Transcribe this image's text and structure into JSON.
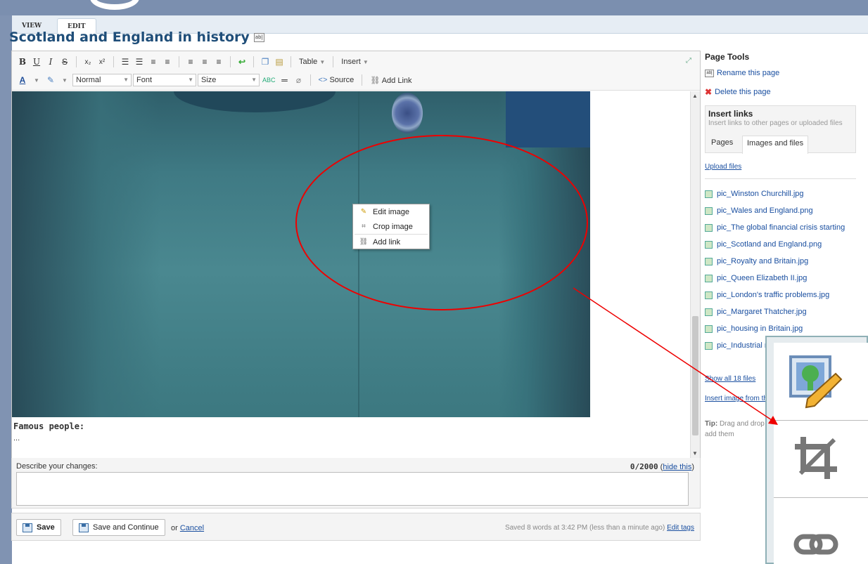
{
  "tabs": {
    "view": "VIEW",
    "edit": "EDIT"
  },
  "page": {
    "title": "Scotland and England in history"
  },
  "toolbar": {
    "bold": "B",
    "underline": "U",
    "italic": "I",
    "strike": "S",
    "table": "Table",
    "insert": "Insert",
    "format_value": "Normal",
    "font_value": "Font",
    "size_value": "Size",
    "source": "Source",
    "add_link": "Add Link"
  },
  "context_menu": {
    "items": [
      "Edit image",
      "Crop image",
      "Add link"
    ]
  },
  "content": {
    "heading": "Famous people:",
    "line": "..."
  },
  "changes": {
    "label": "Describe your changes:",
    "count": "0/2000",
    "hide": "hide this"
  },
  "buttons": {
    "save": "Save",
    "save_continue": "Save and Continue",
    "or": "or",
    "cancel": "Cancel"
  },
  "status": {
    "saved": "Saved 8 words at 3:42 PM (less than a minute ago)",
    "edit_tags": "Edit tags"
  },
  "sidebar": {
    "heading": "Page Tools",
    "rename": "Rename this page",
    "delete": "Delete this page",
    "insert_links_title": "Insert links",
    "insert_links_sub": "Insert links to other pages or uploaded files",
    "tab_pages": "Pages",
    "tab_images": "Images and files",
    "upload": "Upload files",
    "files": [
      "pic_Winston Churchill.jpg",
      "pic_Wales and England.png",
      "pic_The global financial crisis starting",
      "pic_Scotland and England.png",
      "pic_Royalty and Britain.jpg",
      "pic_Queen Elizabeth II.jpg",
      "pic_London's traffic problems.jpg",
      "pic_Margaret Thatcher.jpg",
      "pic_housing in Britain.jpg",
      "pic_Industrial revolution.jpg"
    ],
    "show_all": "Show all 18 files",
    "insert_web": "Insert image from the web",
    "tip_label": "Tip:",
    "tip_text": "Drag and drop files from your desktop to add them"
  },
  "colors": {
    "title": "#1f4e79",
    "link": "#1a4fa0",
    "highlight_ellipse": "#e00000",
    "top_band": "#7b8faf"
  }
}
